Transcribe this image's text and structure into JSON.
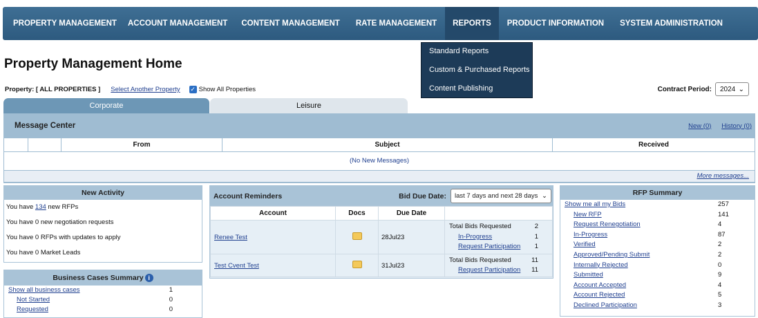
{
  "nav": {
    "items": [
      {
        "label": "PROPERTY MANAGEMENT"
      },
      {
        "label": "ACCOUNT MANAGEMENT"
      },
      {
        "label": "CONTENT MANAGEMENT"
      },
      {
        "label": "RATE MANAGEMENT"
      },
      {
        "label": "REPORTS"
      },
      {
        "label": "PRODUCT INFORMATION"
      },
      {
        "label": "SYSTEM ADMINISTRATION"
      }
    ],
    "reports_menu": [
      "Standard Reports",
      "Custom & Purchased Reports",
      "Content Publishing"
    ]
  },
  "page_title": "Property Management Home",
  "property": {
    "label": "Property: [ ALL PROPERTIES ]",
    "select_link": "Select Another Property",
    "show_all_label": "Show All Properties",
    "show_all_checked": true
  },
  "contract": {
    "label": "Contract Period:",
    "value": "2024"
  },
  "tabs": {
    "corporate": "Corporate",
    "leisure": "Leisure"
  },
  "message_center": {
    "title": "Message Center",
    "new_link": "New (0)",
    "history_link": "History (0)",
    "columns": {
      "from": "From",
      "subject": "Subject",
      "received": "Received"
    },
    "empty_text": "(No New Messages)",
    "more_link": "More messages..."
  },
  "new_activity": {
    "title": "New Activity",
    "l1_pre": "You have ",
    "l1_count": "134",
    "l1_post": " new RFPs",
    "l2": "You have 0 new negotiation requests",
    "l3": "You have 0 RFPs with updates to apply",
    "l4": "You have 0 Market Leads"
  },
  "business_cases": {
    "title": "Business Cases Summary",
    "rows": [
      {
        "label": "Show all business cases",
        "value": "1"
      },
      {
        "label": "Not Started",
        "value": "0"
      },
      {
        "label": "Requested",
        "value": "0"
      }
    ]
  },
  "account_reminders": {
    "title": "Account Reminders",
    "bid_due_label": "Bid Due Date:",
    "bid_due_value": "last 7 days and next 28 days",
    "columns": {
      "account": "Account",
      "docs": "Docs",
      "due": "Due Date"
    },
    "rows": [
      {
        "account": "Renee Test",
        "due": "28Jul23",
        "total_label": "Total Bids Requested",
        "total": "2",
        "s1_label": "In-Progress",
        "s1": "1",
        "s2_label": "Request Participation",
        "s2": "1"
      },
      {
        "account": "Test Cvent Test",
        "due": "31Jul23",
        "total_label": "Total Bids Requested",
        "total": "11",
        "s1_label": "Request Participation",
        "s1": "11"
      }
    ]
  },
  "rfp_summary": {
    "title": "RFP Summary",
    "rows": [
      {
        "label": "Show me all my Bids",
        "value": "257"
      },
      {
        "label": "New RFP",
        "value": "141"
      },
      {
        "label": "Request Renegotiation",
        "value": "4"
      },
      {
        "label": "In-Progress",
        "value": "87"
      },
      {
        "label": "Verified",
        "value": "2"
      },
      {
        "label": "Approved/Pending Submit",
        "value": "2"
      },
      {
        "label": "Internally Rejected",
        "value": "0"
      },
      {
        "label": "Submitted",
        "value": "9"
      },
      {
        "label": "Account Accepted",
        "value": "4"
      },
      {
        "label": "Account Rejected",
        "value": "5"
      },
      {
        "label": "Declined Participation",
        "value": "3"
      }
    ]
  }
}
